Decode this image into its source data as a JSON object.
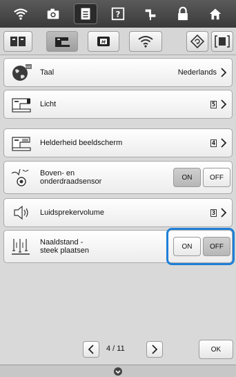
{
  "toolbar": {
    "icons": [
      "wifi-icon",
      "camera-icon",
      "document-icon",
      "help-icon",
      "needle-icon",
      "lock-icon",
      "home-icon"
    ]
  },
  "tabs": [
    "book-icon",
    "sewing-machine-icon",
    "embroidery-icon",
    "wifi-tab-icon",
    "reset-icon",
    "fullscreen-icon"
  ],
  "settings": {
    "language": {
      "label": "Taal",
      "value": "Nederlands"
    },
    "light": {
      "label": "Licht",
      "value": "5"
    },
    "brightness": {
      "label": "Helderheid beeldscherm",
      "value": "4"
    },
    "thread_sensor": {
      "label": "Boven- en\nonderdraadsensor",
      "on": "ON",
      "off": "OFF",
      "state": "ON"
    },
    "speaker": {
      "label": "Luidsprekervolume",
      "value": "3"
    },
    "needle_pos": {
      "label": "Naaldstand -\nsteek plaatsen",
      "on": "ON",
      "off": "OFF",
      "state": "OFF"
    }
  },
  "pager": {
    "text": "4 / 11"
  },
  "ok_label": "OK",
  "colors": {
    "highlight": "#1e7fd8",
    "toolbar": "#4a4a4a"
  }
}
